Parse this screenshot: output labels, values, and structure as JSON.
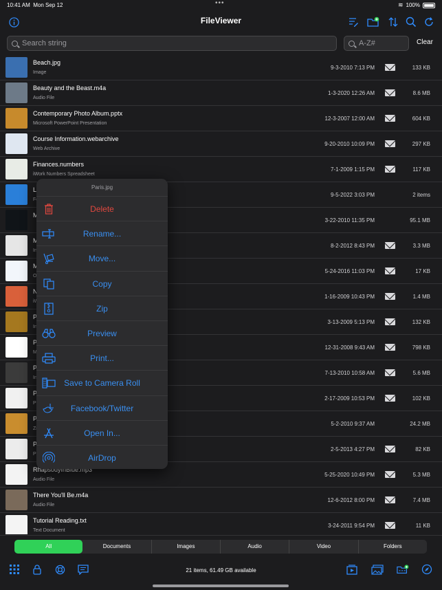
{
  "status_bar": {
    "time": "10:41 AM",
    "date": "Mon Sep 12",
    "battery": "100%"
  },
  "nav": {
    "title": "FileViewer",
    "icons": [
      "info-icon",
      "edit-list-icon",
      "new-folder-icon",
      "sort-icon",
      "search-icon",
      "refresh-icon"
    ]
  },
  "search": {
    "placeholder": "Search string",
    "sort_placeholder": "A-Z#",
    "clear_label": "Clear"
  },
  "files": [
    {
      "name": "Beach.jpg",
      "type": "Image",
      "date": "9-3-2010 7:13 PM",
      "size": "133 KB",
      "mail": true,
      "thumb_color": "#3a6fb0"
    },
    {
      "name": "Beauty and the Beast.m4a",
      "type": "Audio File",
      "date": "1-3-2020 12:26 AM",
      "size": "8.6 MB",
      "mail": true,
      "thumb_color": "#6d7a88"
    },
    {
      "name": "Contemporary Photo Album.pptx",
      "type": "Microsoft PowerPoint Presentation",
      "date": "12-3-2007 12:00 AM",
      "size": "604 KB",
      "mail": true,
      "thumb_color": "#c78a2c"
    },
    {
      "name": "Course Information.webarchive",
      "type": "Web Archive",
      "date": "9-20-2010 10:09 PM",
      "size": "297 KB",
      "mail": true,
      "thumb_color": "#dfe7f1"
    },
    {
      "name": "Finances.numbers",
      "type": "iWork Numbers Spreadsheet",
      "date": "7-1-2009 1:15 PM",
      "size": "117 KB",
      "mail": true,
      "thumb_color": "#e8ece6"
    },
    {
      "name": "L",
      "type": "Fo",
      "date": "9-5-2022 3:03 PM",
      "size": "2 items",
      "mail": false,
      "thumb_color": "#2a7fd9"
    },
    {
      "name": "M",
      "type": "",
      "date": "3-22-2010 11:35 PM",
      "size": "95.1 MB",
      "mail": false,
      "thumb_color": "#101418"
    },
    {
      "name": "M",
      "type": "In",
      "date": "8-2-2012 8:43 PM",
      "size": "3.3 MB",
      "mail": true,
      "thumb_color": "#e6e6e6"
    },
    {
      "name": "M",
      "type": "O",
      "date": "5-24-2016 11:03 PM",
      "size": "17 KB",
      "mail": true,
      "thumb_color": "#f2f6fb"
    },
    {
      "name": "N",
      "type": "iW",
      "date": "1-16-2009 10:43 PM",
      "size": "1.4 MB",
      "mail": true,
      "thumb_color": "#d9603a"
    },
    {
      "name": "P",
      "type": "In",
      "date": "3-13-2009 5:13 PM",
      "size": "132 KB",
      "mail": true,
      "thumb_color": "#a5781f"
    },
    {
      "name": "P",
      "type": "M",
      "date": "12-31-2008 9:43 AM",
      "size": "798 KB",
      "mail": true,
      "thumb_color": "#ffffff"
    },
    {
      "name": "P",
      "type": "In",
      "date": "7-13-2010 10:58 AM",
      "size": "5.6 MB",
      "mail": true,
      "thumb_color": "#3b3b3b"
    },
    {
      "name": "P",
      "type": "Pl",
      "date": "2-17-2009 10:53 PM",
      "size": "102 KB",
      "mail": true,
      "thumb_color": "#f0f0f0"
    },
    {
      "name": "P",
      "type": "Zi",
      "date": "5-2-2010 9:37 AM",
      "size": "24.2 MB",
      "mail": false,
      "thumb_color": "#c98d2e"
    },
    {
      "name": "P",
      "type": "P",
      "date": "2-5-2013 4:27 PM",
      "size": "82 KB",
      "mail": true,
      "thumb_color": "#ececec"
    },
    {
      "name": "RhapsodyInBlue.mp3",
      "type": "Audio File",
      "date": "5-25-2020 10:49 PM",
      "size": "5.3 MB",
      "mail": true,
      "thumb_color": "#f3f3f3"
    },
    {
      "name": "There You'll Be.m4a",
      "type": "Audio File",
      "date": "12-6-2012 8:00 PM",
      "size": "7.4 MB",
      "mail": true,
      "thumb_color": "#7a6a5a"
    },
    {
      "name": "Tutorial Reading.txt",
      "type": "Text Document",
      "date": "3-24-2011 9:54 PM",
      "size": "11 KB",
      "mail": true,
      "thumb_color": "#f4f4f4"
    }
  ],
  "context_menu": {
    "title": "Paris.jpg",
    "items": [
      {
        "label": "Delete",
        "icon": "trash-icon",
        "destructive": true
      },
      {
        "label": "Rename...",
        "icon": "rename-icon",
        "destructive": false
      },
      {
        "label": "Move...",
        "icon": "move-icon",
        "destructive": false
      },
      {
        "label": "Copy",
        "icon": "copy-icon",
        "destructive": false
      },
      {
        "label": "Zip",
        "icon": "zip-icon",
        "destructive": false
      },
      {
        "label": "Preview",
        "icon": "binoculars-icon",
        "destructive": false
      },
      {
        "label": "Print...",
        "icon": "printer-icon",
        "destructive": false
      },
      {
        "label": "Save to Camera Roll",
        "icon": "camera-roll-icon",
        "destructive": false
      },
      {
        "label": "Facebook/Twitter",
        "icon": "social-share-icon",
        "destructive": false
      },
      {
        "label": "Open In...",
        "icon": "open-in-icon",
        "destructive": false
      },
      {
        "label": "AirDrop",
        "icon": "airdrop-icon",
        "destructive": false
      }
    ]
  },
  "segments": [
    "All",
    "Documents",
    "Images",
    "Audio",
    "Video",
    "Folders"
  ],
  "active_segment": "All",
  "bottom": {
    "status": "21 items, 61.49 GB available",
    "left_icons": [
      "grid-icon",
      "lock-icon",
      "help-icon",
      "chat-icon"
    ],
    "right_icons": [
      "slideshow-icon",
      "photos-icon",
      "add-folder-icon",
      "compass-icon"
    ]
  },
  "colors": {
    "accent": "#2f8cff",
    "destructive": "#e0483f",
    "active_segment": "#30d158",
    "background": "#1c1c1e"
  }
}
